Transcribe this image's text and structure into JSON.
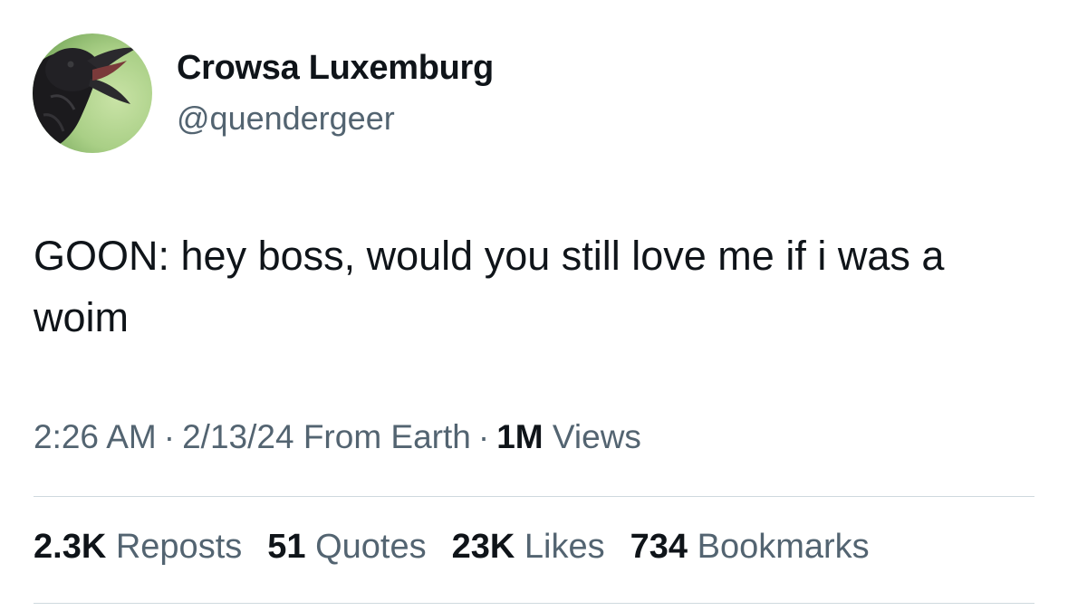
{
  "author": {
    "display_name": "Crowsa Luxemburg",
    "handle": "@quendergeer",
    "avatar_icon": "crow-avatar"
  },
  "tweet": {
    "text": "GOON: hey boss, would you still love me if i was a woim"
  },
  "meta": {
    "time": "2:26 AM",
    "separator": "·",
    "date": "2/13/24",
    "source": "From Earth",
    "views_count": "1M",
    "views_label": "Views"
  },
  "stats": {
    "reposts_count": "2.3K",
    "reposts_label": "Reposts",
    "quotes_count": "51",
    "quotes_label": "Quotes",
    "likes_count": "23K",
    "likes_label": "Likes",
    "bookmarks_count": "734",
    "bookmarks_label": "Bookmarks"
  },
  "colors": {
    "text_primary": "#0f1419",
    "text_secondary": "#536471",
    "divider": "#cfd9de"
  }
}
